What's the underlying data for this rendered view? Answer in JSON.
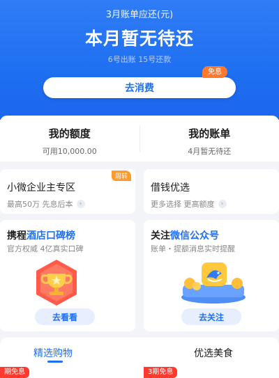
{
  "header": {
    "bill_title": "3月账单应还(元)",
    "status": "本月暂无待还",
    "dates": "6号出账  15号还款",
    "consume_button": "去消费",
    "interest_badge": "免息"
  },
  "quota": {
    "left": {
      "label": "我的额度",
      "sub": "可用10,000.00"
    },
    "right": {
      "label": "我的账单",
      "sub": "4月暂无待还"
    }
  },
  "mini_cards": [
    {
      "title": "小微企业主专区",
      "sub": "最高50万 先息后本",
      "badge": "周转"
    },
    {
      "title": "借钱优选",
      "sub": "更多选择 更高额度"
    }
  ],
  "big_cards": [
    {
      "title_prefix": "携程",
      "title_accent": "酒店口碑榜",
      "desc": "官方权威 4亿真实口碑",
      "button": "去看看",
      "icon": "trophy-icon"
    },
    {
      "title_prefix": "关注",
      "title_accent": "微信公众号",
      "desc": "账单・提额消息实时提醒",
      "button": "去关注",
      "icon": "dolphin-mascot-icon"
    }
  ],
  "tabs": [
    {
      "label": "精选购物",
      "active": true
    },
    {
      "label": "优选美食",
      "active": false
    }
  ],
  "promo_tags": [
    "期免息",
    "3期免息"
  ],
  "colors": {
    "primary": "#1f6ff1",
    "orange": "#ff7a2f",
    "red": "#ff3b2f"
  }
}
